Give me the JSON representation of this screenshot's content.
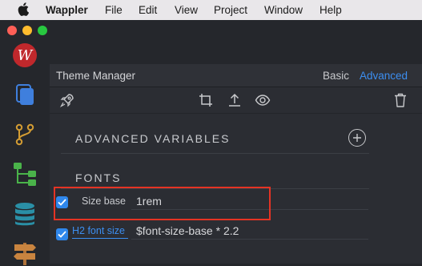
{
  "menubar": {
    "app_name": "Wappler",
    "items": [
      "File",
      "Edit",
      "View",
      "Project",
      "Window",
      "Help"
    ]
  },
  "panel": {
    "title": "Theme Manager",
    "modes": {
      "basic": "Basic",
      "advanced": "Advanced",
      "active": "advanced"
    },
    "toolbar_icons": [
      "rocket-icon",
      "crop-icon",
      "upload-icon",
      "eye-icon",
      "trash-icon"
    ]
  },
  "sections": {
    "advanced_variables": "ADVANCED VARIABLES",
    "fonts": "FONTS"
  },
  "properties": [
    {
      "label": "Size base",
      "value": "1rem",
      "checked": true,
      "label_is_link": false
    },
    {
      "label": "H2 font size",
      "value": "$font-size-base * 2.2",
      "checked": true,
      "label_is_link": true
    }
  ],
  "colors": {
    "accent": "#3c8ef0",
    "highlight": "#e53324",
    "brand": "#c0282c"
  }
}
